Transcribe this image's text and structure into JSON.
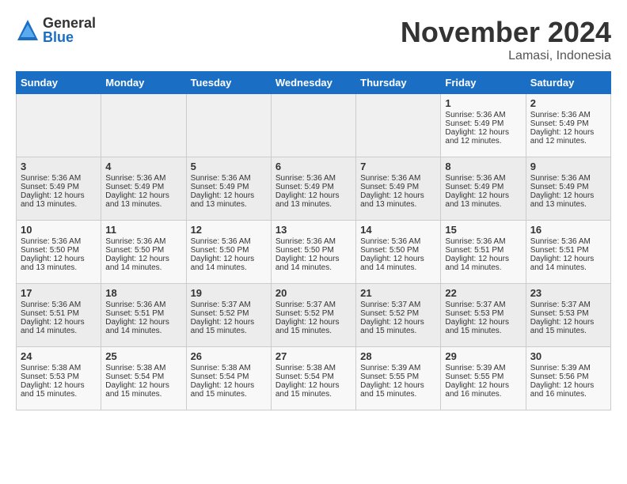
{
  "header": {
    "logo_general": "General",
    "logo_blue": "Blue",
    "month_title": "November 2024",
    "location": "Lamasi, Indonesia"
  },
  "days_of_week": [
    "Sunday",
    "Monday",
    "Tuesday",
    "Wednesday",
    "Thursday",
    "Friday",
    "Saturday"
  ],
  "weeks": [
    [
      {
        "day": "",
        "empty": true
      },
      {
        "day": "",
        "empty": true
      },
      {
        "day": "",
        "empty": true
      },
      {
        "day": "",
        "empty": true
      },
      {
        "day": "",
        "empty": true
      },
      {
        "day": "1",
        "sunrise": "Sunrise: 5:36 AM",
        "sunset": "Sunset: 5:49 PM",
        "daylight": "Daylight: 12 hours and 12 minutes."
      },
      {
        "day": "2",
        "sunrise": "Sunrise: 5:36 AM",
        "sunset": "Sunset: 5:49 PM",
        "daylight": "Daylight: 12 hours and 12 minutes."
      }
    ],
    [
      {
        "day": "3",
        "sunrise": "Sunrise: 5:36 AM",
        "sunset": "Sunset: 5:49 PM",
        "daylight": "Daylight: 12 hours and 13 minutes."
      },
      {
        "day": "4",
        "sunrise": "Sunrise: 5:36 AM",
        "sunset": "Sunset: 5:49 PM",
        "daylight": "Daylight: 12 hours and 13 minutes."
      },
      {
        "day": "5",
        "sunrise": "Sunrise: 5:36 AM",
        "sunset": "Sunset: 5:49 PM",
        "daylight": "Daylight: 12 hours and 13 minutes."
      },
      {
        "day": "6",
        "sunrise": "Sunrise: 5:36 AM",
        "sunset": "Sunset: 5:49 PM",
        "daylight": "Daylight: 12 hours and 13 minutes."
      },
      {
        "day": "7",
        "sunrise": "Sunrise: 5:36 AM",
        "sunset": "Sunset: 5:49 PM",
        "daylight": "Daylight: 12 hours and 13 minutes."
      },
      {
        "day": "8",
        "sunrise": "Sunrise: 5:36 AM",
        "sunset": "Sunset: 5:49 PM",
        "daylight": "Daylight: 12 hours and 13 minutes."
      },
      {
        "day": "9",
        "sunrise": "Sunrise: 5:36 AM",
        "sunset": "Sunset: 5:49 PM",
        "daylight": "Daylight: 12 hours and 13 minutes."
      }
    ],
    [
      {
        "day": "10",
        "sunrise": "Sunrise: 5:36 AM",
        "sunset": "Sunset: 5:50 PM",
        "daylight": "Daylight: 12 hours and 13 minutes."
      },
      {
        "day": "11",
        "sunrise": "Sunrise: 5:36 AM",
        "sunset": "Sunset: 5:50 PM",
        "daylight": "Daylight: 12 hours and 14 minutes."
      },
      {
        "day": "12",
        "sunrise": "Sunrise: 5:36 AM",
        "sunset": "Sunset: 5:50 PM",
        "daylight": "Daylight: 12 hours and 14 minutes."
      },
      {
        "day": "13",
        "sunrise": "Sunrise: 5:36 AM",
        "sunset": "Sunset: 5:50 PM",
        "daylight": "Daylight: 12 hours and 14 minutes."
      },
      {
        "day": "14",
        "sunrise": "Sunrise: 5:36 AM",
        "sunset": "Sunset: 5:50 PM",
        "daylight": "Daylight: 12 hours and 14 minutes."
      },
      {
        "day": "15",
        "sunrise": "Sunrise: 5:36 AM",
        "sunset": "Sunset: 5:51 PM",
        "daylight": "Daylight: 12 hours and 14 minutes."
      },
      {
        "day": "16",
        "sunrise": "Sunrise: 5:36 AM",
        "sunset": "Sunset: 5:51 PM",
        "daylight": "Daylight: 12 hours and 14 minutes."
      }
    ],
    [
      {
        "day": "17",
        "sunrise": "Sunrise: 5:36 AM",
        "sunset": "Sunset: 5:51 PM",
        "daylight": "Daylight: 12 hours and 14 minutes."
      },
      {
        "day": "18",
        "sunrise": "Sunrise: 5:36 AM",
        "sunset": "Sunset: 5:51 PM",
        "daylight": "Daylight: 12 hours and 14 minutes."
      },
      {
        "day": "19",
        "sunrise": "Sunrise: 5:37 AM",
        "sunset": "Sunset: 5:52 PM",
        "daylight": "Daylight: 12 hours and 15 minutes."
      },
      {
        "day": "20",
        "sunrise": "Sunrise: 5:37 AM",
        "sunset": "Sunset: 5:52 PM",
        "daylight": "Daylight: 12 hours and 15 minutes."
      },
      {
        "day": "21",
        "sunrise": "Sunrise: 5:37 AM",
        "sunset": "Sunset: 5:52 PM",
        "daylight": "Daylight: 12 hours and 15 minutes."
      },
      {
        "day": "22",
        "sunrise": "Sunrise: 5:37 AM",
        "sunset": "Sunset: 5:53 PM",
        "daylight": "Daylight: 12 hours and 15 minutes."
      },
      {
        "day": "23",
        "sunrise": "Sunrise: 5:37 AM",
        "sunset": "Sunset: 5:53 PM",
        "daylight": "Daylight: 12 hours and 15 minutes."
      }
    ],
    [
      {
        "day": "24",
        "sunrise": "Sunrise: 5:38 AM",
        "sunset": "Sunset: 5:53 PM",
        "daylight": "Daylight: 12 hours and 15 minutes."
      },
      {
        "day": "25",
        "sunrise": "Sunrise: 5:38 AM",
        "sunset": "Sunset: 5:54 PM",
        "daylight": "Daylight: 12 hours and 15 minutes."
      },
      {
        "day": "26",
        "sunrise": "Sunrise: 5:38 AM",
        "sunset": "Sunset: 5:54 PM",
        "daylight": "Daylight: 12 hours and 15 minutes."
      },
      {
        "day": "27",
        "sunrise": "Sunrise: 5:38 AM",
        "sunset": "Sunset: 5:54 PM",
        "daylight": "Daylight: 12 hours and 15 minutes."
      },
      {
        "day": "28",
        "sunrise": "Sunrise: 5:39 AM",
        "sunset": "Sunset: 5:55 PM",
        "daylight": "Daylight: 12 hours and 15 minutes."
      },
      {
        "day": "29",
        "sunrise": "Sunrise: 5:39 AM",
        "sunset": "Sunset: 5:55 PM",
        "daylight": "Daylight: 12 hours and 16 minutes."
      },
      {
        "day": "30",
        "sunrise": "Sunrise: 5:39 AM",
        "sunset": "Sunset: 5:56 PM",
        "daylight": "Daylight: 12 hours and 16 minutes."
      }
    ]
  ]
}
